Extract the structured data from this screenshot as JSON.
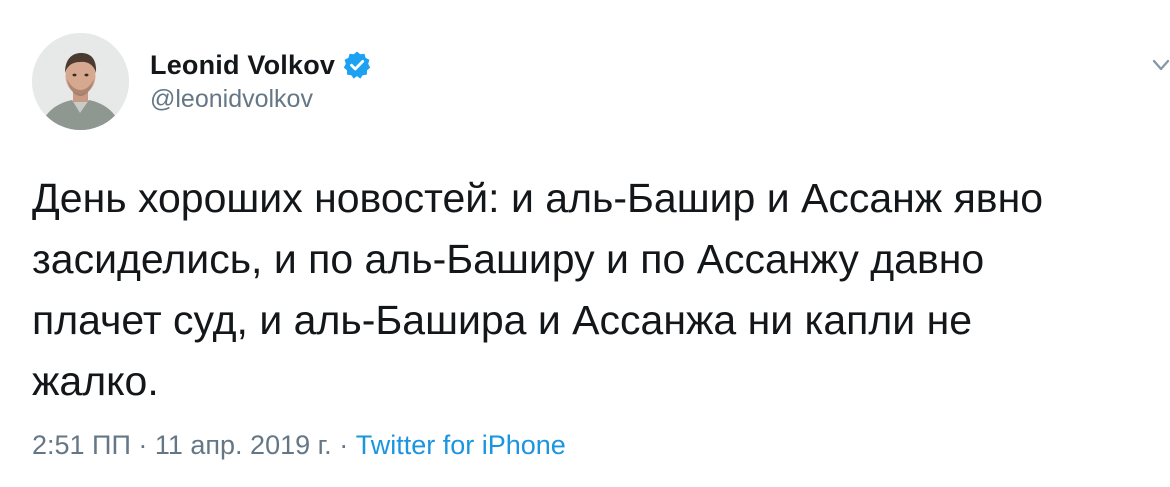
{
  "author": {
    "display_name": "Leonid Volkov",
    "handle": "@leonidvolkov",
    "verified": true
  },
  "tweet": {
    "text": "День хороших новостей: и аль-Башир и Ассанж явно\nзасиделись, и по аль-Баширу и по Ассанжу давно\nплачет суд, и аль-Башира и Ассанжа ни капли не\nжалко."
  },
  "meta": {
    "time": "2:51 ПП",
    "separator": " · ",
    "date": "11 апр. 2019 г.",
    "source": "Twitter for iPhone"
  },
  "icons": {
    "verified": "verified-badge-icon",
    "caret": "chevron-down-icon"
  },
  "colors": {
    "accent": "#1da1f2",
    "link": "#1b95e0",
    "text": "#14171a",
    "secondary": "#657786"
  }
}
